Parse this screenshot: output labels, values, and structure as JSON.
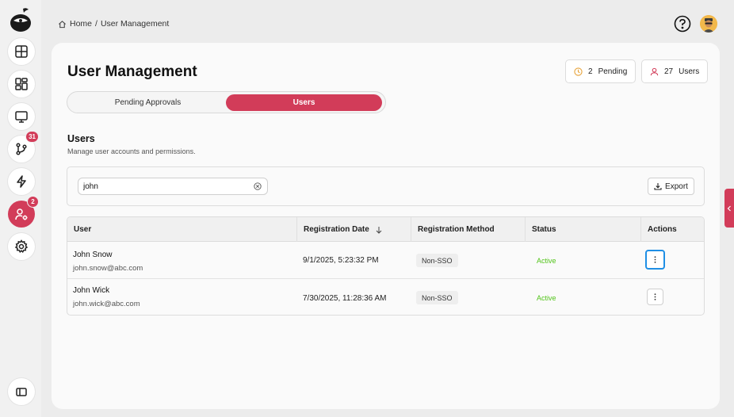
{
  "breadcrumb": {
    "home": "Home",
    "separator": "/",
    "current": "User Management"
  },
  "sidebar": {
    "badges": {
      "git": "31",
      "users": "2"
    }
  },
  "header": {
    "help_icon": "question-circle-icon",
    "avatar_icon": "user-avatar"
  },
  "page": {
    "title": "User Management",
    "pending_count": "2",
    "pending_label": "Pending",
    "users_count": "27",
    "users_label": "Users"
  },
  "tabs": [
    {
      "label": "Pending Approvals",
      "active": false
    },
    {
      "label": "Users",
      "active": true
    }
  ],
  "section": {
    "title": "Users",
    "subtitle": "Manage user accounts and permissions."
  },
  "search": {
    "value": "john",
    "placeholder": ""
  },
  "export": {
    "label": "Export"
  },
  "table": {
    "columns": [
      "User",
      "Registration Date",
      "Registration Method",
      "Status",
      "Actions"
    ],
    "rows": [
      {
        "name": "John Snow",
        "email": "john.snow@abc.com",
        "date": "9/1/2025, 5:23:32 PM",
        "method": "Non-SSO",
        "status": "Active"
      },
      {
        "name": "John Wick",
        "email": "john.wick@abc.com",
        "date": "7/30/2025, 11:28:36 AM",
        "method": "Non-SSO",
        "status": "Active"
      }
    ]
  },
  "colors": {
    "accent": "#d23c59",
    "status_active": "#52c41a",
    "focus_ring": "#1f8fe5"
  }
}
